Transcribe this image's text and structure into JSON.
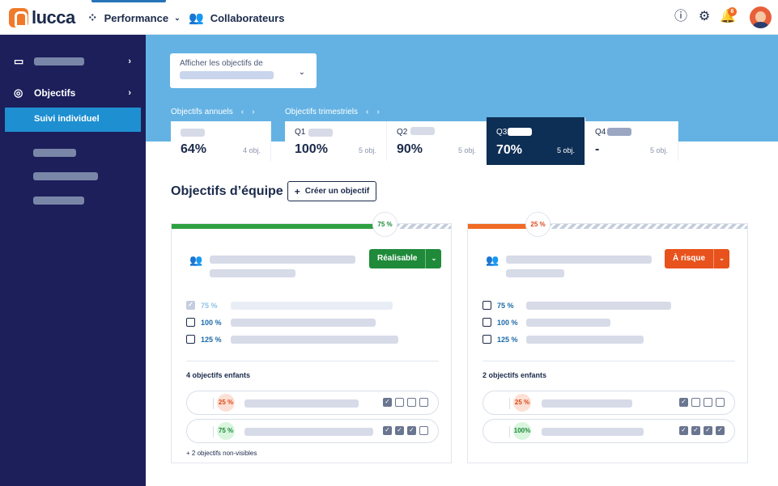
{
  "header": {
    "logo_text": "lucca",
    "nav": [
      {
        "label": "Performance",
        "icon": "grid-icon",
        "active": true
      },
      {
        "label": "Collaborateurs",
        "icon": "users-icon",
        "active": false
      }
    ],
    "icons": [
      "info-icon",
      "gear-icon",
      "bell-icon"
    ],
    "notification_count": "6"
  },
  "sidebar": {
    "items": [
      {
        "label": "",
        "icon": "chat-icon"
      },
      {
        "label": "Objectifs",
        "icon": "target-icon"
      }
    ],
    "active_subitem": "Suivi individuel"
  },
  "filter": {
    "label": "Afficher les objectifs de"
  },
  "periods": {
    "annual_label": "Objectifs annuels",
    "quarterly_label": "Objectifs trimestriels",
    "cards": [
      {
        "name": "",
        "pct": "64%",
        "objs": "4 obj."
      },
      {
        "name": "Q1",
        "pct": "100%",
        "objs": "5 obj."
      },
      {
        "name": "Q2",
        "pct": "90%",
        "objs": "5 obj."
      },
      {
        "name": "Q3",
        "pct": "70%",
        "objs": "5 obj."
      },
      {
        "name": "Q4",
        "pct": "-",
        "objs": "5 obj."
      }
    ],
    "active_index": 3
  },
  "team": {
    "title": "Objectifs d’équipe",
    "create_label": "Créer un objectif",
    "cards": [
      {
        "progress_label": "75 %",
        "progress": 0.75,
        "progress_color": "#2fa142",
        "status": "Réalisable",
        "status_color": "#1f8a3a",
        "krs": [
          {
            "label": "75 %",
            "done": true
          },
          {
            "label": "100 %",
            "done": false
          },
          {
            "label": "125 %",
            "done": false
          }
        ],
        "children_title": "4 objectifs enfants",
        "children": [
          {
            "pct": "25 %",
            "tone": "red",
            "checked": 1
          },
          {
            "pct": "75 %",
            "tone": "green",
            "checked": 3
          }
        ],
        "hidden_note": "+ 2 objectifs non-visibles"
      },
      {
        "progress_label": "25 %",
        "progress": 0.25,
        "progress_color": "#f06b25",
        "status": "À risque",
        "status_color": "#e8521c",
        "krs": [
          {
            "label": "75 %",
            "done": false
          },
          {
            "label": "100 %",
            "done": false
          },
          {
            "label": "125 %",
            "done": false
          }
        ],
        "children_title": "2 objectifs enfants",
        "children": [
          {
            "pct": "25 %",
            "tone": "red",
            "checked": 1
          },
          {
            "pct": "100%",
            "tone": "green",
            "checked": 4
          }
        ],
        "hidden_note": ""
      }
    ]
  }
}
